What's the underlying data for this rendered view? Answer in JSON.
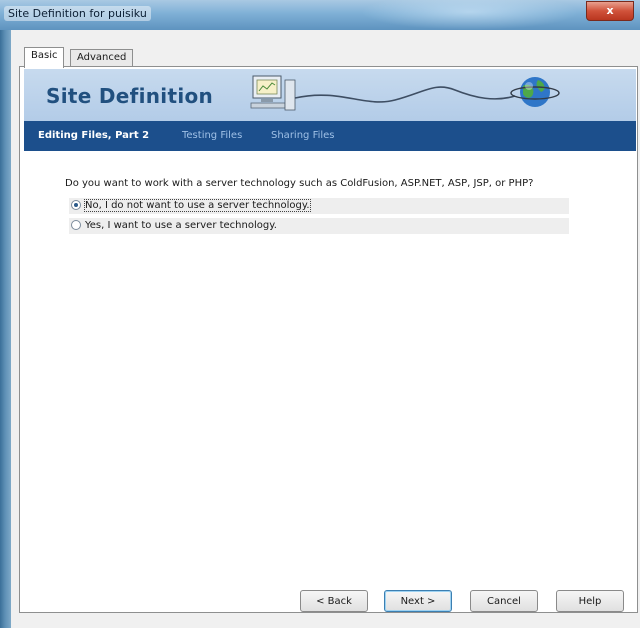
{
  "window": {
    "title": "Site Definition for puisiku",
    "close_glyph": "x"
  },
  "tabs": [
    {
      "label": "Basic",
      "active": true
    },
    {
      "label": "Advanced",
      "active": false
    }
  ],
  "banner": {
    "title": "Site Definition",
    "illustration_icons": [
      "computer-icon",
      "globe-icon"
    ]
  },
  "steps": [
    {
      "label": "Editing Files, Part 2",
      "current": true
    },
    {
      "label": "Testing Files",
      "current": false
    },
    {
      "label": "Sharing Files",
      "current": false
    }
  ],
  "content": {
    "question": "Do you want to work with a server technology such as ColdFusion, ASP.NET, ASP, JSP, or PHP?",
    "options": [
      {
        "label": "No, I do not want to use a server technology.",
        "selected": true
      },
      {
        "label": "Yes, I want to use a server technology.",
        "selected": false
      }
    ]
  },
  "buttons": {
    "back": "< Back",
    "next": "Next >",
    "cancel": "Cancel",
    "help": "Help"
  },
  "colors": {
    "banner_bg": "#b9d0ea",
    "stepbar_bg": "#1c4f8c",
    "title_color": "#21507f"
  }
}
